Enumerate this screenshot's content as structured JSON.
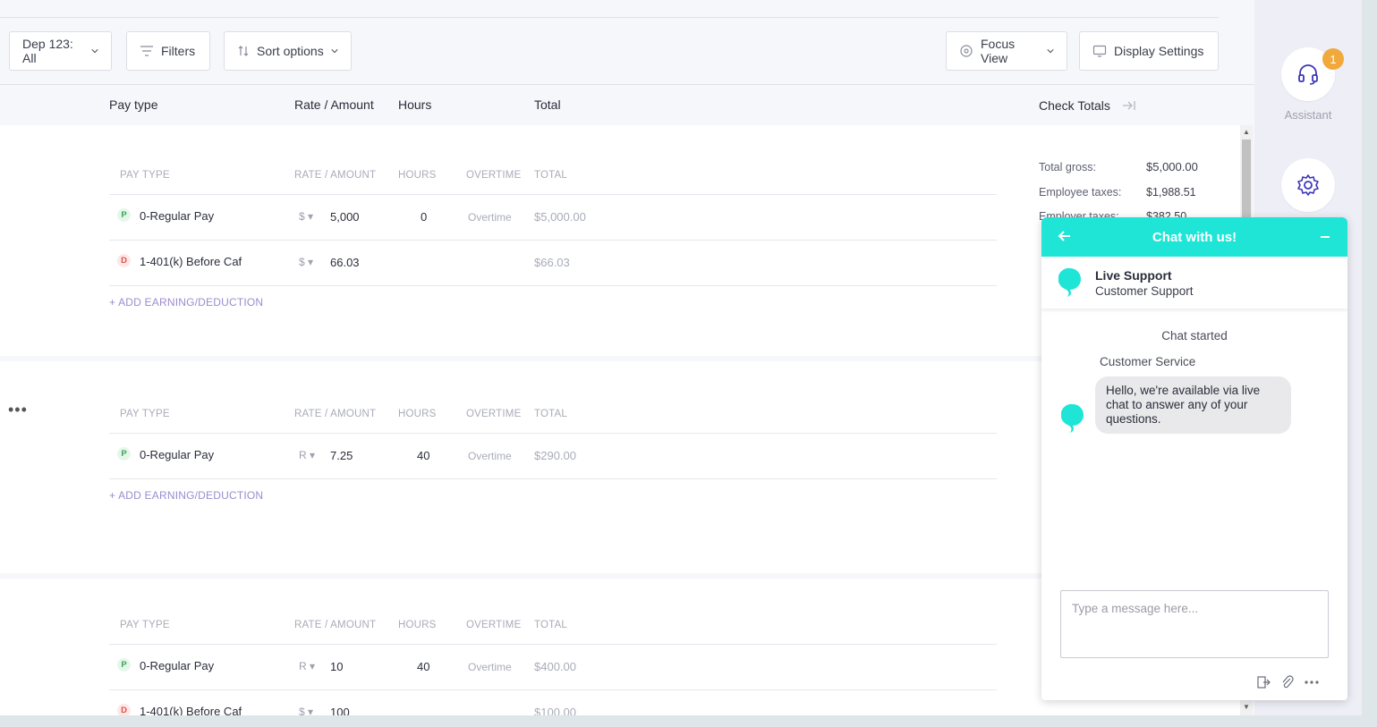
{
  "toolbar": {
    "department": "Dep 123: All",
    "filters": "Filters",
    "sort": "Sort options",
    "focus_view": "Focus View",
    "display_settings": "Display Settings"
  },
  "columns": {
    "pay_type": "Pay type",
    "rate_amount": "Rate / Amount",
    "hours": "Hours",
    "total": "Total",
    "check_totals": "Check Totals"
  },
  "sub_headers": {
    "pay_type": "PAY TYPE",
    "rate_amount": "RATE / AMOUNT",
    "hours": "HOURS",
    "overtime": "OVERTIME",
    "total": "TOTAL"
  },
  "add_link": "+ ADD EARNING/DEDUCTION",
  "cards": [
    {
      "rows": [
        {
          "badge": "P",
          "name": "0-Regular Pay",
          "unit": "$",
          "rate": "5,000",
          "hours": "0",
          "overtime": "Overtime",
          "total": "$5,000.00"
        },
        {
          "badge": "D",
          "name": "1-401(k) Before Caf",
          "unit": "$",
          "rate": "66.03",
          "hours": "",
          "overtime": "",
          "total": "$66.03"
        }
      ]
    },
    {
      "rows": [
        {
          "badge": "P",
          "name": "0-Regular Pay",
          "unit": "R",
          "rate": "7.25",
          "hours": "40",
          "overtime": "Overtime",
          "total": "$290.00"
        }
      ]
    },
    {
      "rows": [
        {
          "badge": "P",
          "name": "0-Regular Pay",
          "unit": "R",
          "rate": "10",
          "hours": "40",
          "overtime": "Overtime",
          "total": "$400.00"
        },
        {
          "badge": "D",
          "name": "1-401(k) Before Caf",
          "unit": "$",
          "rate": "100",
          "hours": "",
          "overtime": "",
          "total": "$100.00"
        }
      ]
    }
  ],
  "check_totals": {
    "gross_label": "Total gross:",
    "gross_value": "$5,000.00",
    "emp_tax_label": "Employee taxes:",
    "emp_tax_value": "$1,988.51",
    "employer_tax_label": "Employer taxes:",
    "employer_tax_value": "$382.50"
  },
  "rail": {
    "notification_count": "1",
    "assistant_label": "Assistant"
  },
  "chat": {
    "title": "Chat with us!",
    "agent_name": "Live Support",
    "agent_role": "Customer Support",
    "status": "Chat started",
    "sender": "Customer Service",
    "message": "Hello, we're available via live chat to answer any of your questions.",
    "input_placeholder": "Type a message here..."
  },
  "colors": {
    "chat_accent": "#1fe5d6",
    "badge_p": "#3aa35c",
    "badge_d": "#d9534f",
    "notification": "#f0a93a",
    "link": "#9b8ccf"
  }
}
